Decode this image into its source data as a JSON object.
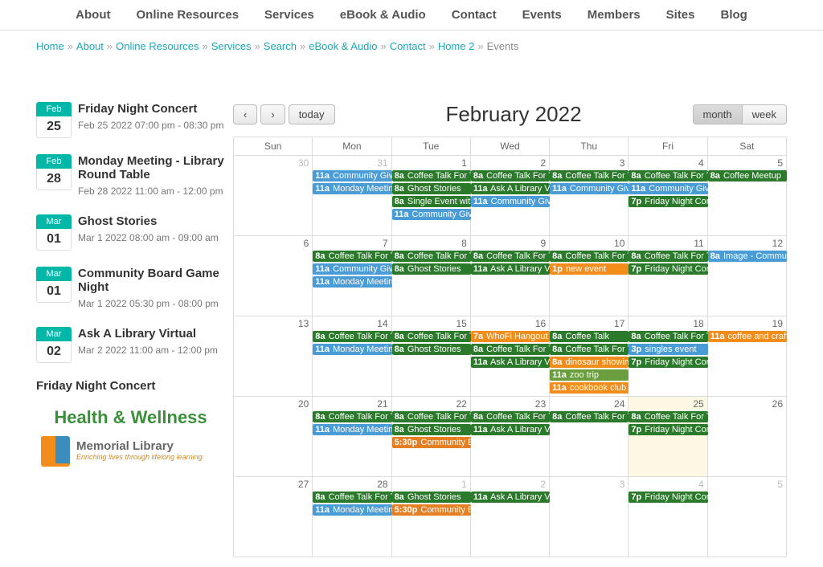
{
  "nav": [
    "About",
    "Online Resources",
    "Services",
    "eBook & Audio",
    "Contact",
    "Events",
    "Members",
    "Sites",
    "Blog"
  ],
  "breadcrumb": [
    "Home",
    "About",
    "Online Resources",
    "Services",
    "Search",
    "eBook & Audio",
    "Contact",
    "Home 2",
    "Events"
  ],
  "sidebar_events": [
    {
      "month": "Feb",
      "day": "25",
      "title": "Friday Night Concert",
      "time": "Feb 25 2022 07:00 pm - 08:30 pm"
    },
    {
      "month": "Feb",
      "day": "28",
      "title": "Monday Meeting - Library Round Table",
      "time": "Feb 28 2022 11:00 am - 12:00 pm"
    },
    {
      "month": "Mar",
      "day": "01",
      "title": "Ghost Stories",
      "time": "Mar 1 2022 08:00 am - 09:00 am"
    },
    {
      "month": "Mar",
      "day": "01",
      "title": "Community Board Game Night",
      "time": "Mar 1 2022 05:30 pm - 08:00 pm"
    },
    {
      "month": "Mar",
      "day": "02",
      "title": "Ask A Library Virtual",
      "time": "Mar 2 2022 11:00 am - 12:00 pm"
    }
  ],
  "sidebar_cut": "Friday Night Concert",
  "hw_title": "Health & Wellness",
  "logo": {
    "line1": "Memorial Library",
    "line2": "Enriching lives through lifelong learning"
  },
  "cal": {
    "title": "February 2022",
    "today_btn": "today",
    "month_btn": "month",
    "week_btn": "week",
    "dow": [
      "Sun",
      "Mon",
      "Tue",
      "Wed",
      "Thu",
      "Fri",
      "Sat"
    ],
    "weeks": [
      [
        {
          "d": "30",
          "other": true,
          "events": []
        },
        {
          "d": "31",
          "other": true,
          "events": [
            {
              "t": "11a",
              "txt": "Community Givi",
              "c": "c-blue"
            },
            {
              "t": "11a",
              "txt": "Monday Meeting",
              "c": "c-blue"
            }
          ]
        },
        {
          "d": "1",
          "events": [
            {
              "t": "8a",
              "txt": "Coffee Talk For T",
              "c": "c-green"
            },
            {
              "t": "8a",
              "txt": "Ghost Stories",
              "c": "c-green"
            },
            {
              "t": "8a",
              "txt": "Single Event with",
              "c": "c-green"
            },
            {
              "t": "11a",
              "txt": "Community Givi",
              "c": "c-blue"
            }
          ]
        },
        {
          "d": "2",
          "events": [
            {
              "t": "8a",
              "txt": "Coffee Talk For T",
              "c": "c-green"
            },
            {
              "t": "11a",
              "txt": "Ask A Library Vir",
              "c": "c-green"
            },
            {
              "t": "11a",
              "txt": "Community Givi",
              "c": "c-blue"
            }
          ]
        },
        {
          "d": "3",
          "events": [
            {
              "t": "8a",
              "txt": "Coffee Talk For T",
              "c": "c-green"
            },
            {
              "t": "11a",
              "txt": "Community Givi",
              "c": "c-blue"
            }
          ]
        },
        {
          "d": "4",
          "events": [
            {
              "t": "8a",
              "txt": "Coffee Talk For T",
              "c": "c-green"
            },
            {
              "t": "11a",
              "txt": "Community Givi",
              "c": "c-blue"
            },
            {
              "t": "7p",
              "txt": "Friday Night Conc",
              "c": "c-green"
            }
          ]
        },
        {
          "d": "5",
          "events": [
            {
              "t": "8a",
              "txt": "Coffee Meetup",
              "c": "c-green"
            }
          ]
        }
      ],
      [
        {
          "d": "6",
          "events": []
        },
        {
          "d": "7",
          "events": [
            {
              "t": "8a",
              "txt": "Coffee Talk For T",
              "c": "c-green"
            },
            {
              "t": "11a",
              "txt": "Community Givi",
              "c": "c-blue"
            },
            {
              "t": "11a",
              "txt": "Monday Meeting",
              "c": "c-blue"
            }
          ]
        },
        {
          "d": "8",
          "events": [
            {
              "t": "8a",
              "txt": "Coffee Talk For T",
              "c": "c-green"
            },
            {
              "t": "8a",
              "txt": "Ghost Stories",
              "c": "c-green"
            }
          ]
        },
        {
          "d": "9",
          "events": [
            {
              "t": "8a",
              "txt": "Coffee Talk For T",
              "c": "c-green"
            },
            {
              "t": "11a",
              "txt": "Ask A Library Vir",
              "c": "c-green"
            }
          ]
        },
        {
          "d": "10",
          "events": [
            {
              "t": "8a",
              "txt": "Coffee Talk For T",
              "c": "c-green"
            },
            {
              "t": "1p",
              "txt": "new event",
              "c": "c-orange"
            }
          ]
        },
        {
          "d": "11",
          "events": [
            {
              "t": "8a",
              "txt": "Coffee Talk For T",
              "c": "c-green"
            },
            {
              "t": "7p",
              "txt": "Friday Night Conc",
              "c": "c-green"
            }
          ]
        },
        {
          "d": "12",
          "events": [
            {
              "t": "8a",
              "txt": "Image - Commun",
              "c": "c-blue"
            }
          ]
        }
      ],
      [
        {
          "d": "13",
          "events": []
        },
        {
          "d": "14",
          "events": [
            {
              "t": "8a",
              "txt": "Coffee Talk For T",
              "c": "c-green"
            },
            {
              "t": "11a",
              "txt": "Monday Meeting",
              "c": "c-blue"
            }
          ]
        },
        {
          "d": "15",
          "events": [
            {
              "t": "8a",
              "txt": "Coffee Talk For T",
              "c": "c-green"
            },
            {
              "t": "8a",
              "txt": "Ghost Stories",
              "c": "c-green"
            }
          ]
        },
        {
          "d": "16",
          "events": [
            {
              "t": "7a",
              "txt": "WhoFi Hangout",
              "c": "c-orange"
            },
            {
              "t": "8a",
              "txt": "Coffee Talk For T",
              "c": "c-green"
            },
            {
              "t": "11a",
              "txt": "Ask A Library Vir",
              "c": "c-green"
            }
          ]
        },
        {
          "d": "17",
          "events": [
            {
              "t": "8a",
              "txt": "Coffee Talk",
              "c": "c-green"
            },
            {
              "t": "8a",
              "txt": "Coffee Talk For T",
              "c": "c-green"
            },
            {
              "t": "8a",
              "txt": "dinosaur showing",
              "c": "c-orange"
            },
            {
              "t": "11a",
              "txt": "zoo trip",
              "c": "c-olive"
            },
            {
              "t": "11a",
              "txt": "cookbook club",
              "c": "c-orange"
            }
          ]
        },
        {
          "d": "18",
          "events": [
            {
              "t": "8a",
              "txt": "Coffee Talk For T",
              "c": "c-green"
            },
            {
              "t": "3p",
              "txt": "singles event",
              "c": "c-blue"
            },
            {
              "t": "7p",
              "txt": "Friday Night Conc",
              "c": "c-green"
            }
          ]
        },
        {
          "d": "19",
          "events": [
            {
              "t": "11a",
              "txt": "coffee and crafts",
              "c": "c-orange"
            }
          ]
        }
      ],
      [
        {
          "d": "20",
          "events": []
        },
        {
          "d": "21",
          "events": [
            {
              "t": "8a",
              "txt": "Coffee Talk For T",
              "c": "c-green"
            },
            {
              "t": "11a",
              "txt": "Monday Meeting",
              "c": "c-blue"
            }
          ]
        },
        {
          "d": "22",
          "events": [
            {
              "t": "8a",
              "txt": "Coffee Talk For T",
              "c": "c-green"
            },
            {
              "t": "8a",
              "txt": "Ghost Stories",
              "c": "c-green"
            },
            {
              "t": "5:30p",
              "txt": "Community Bo",
              "c": "c-orange2"
            }
          ]
        },
        {
          "d": "23",
          "events": [
            {
              "t": "8a",
              "txt": "Coffee Talk For T",
              "c": "c-green"
            },
            {
              "t": "11a",
              "txt": "Ask A Library Vir",
              "c": "c-green"
            }
          ]
        },
        {
          "d": "24",
          "events": [
            {
              "t": "8a",
              "txt": "Coffee Talk For T",
              "c": "c-green"
            }
          ]
        },
        {
          "d": "25",
          "today": true,
          "events": [
            {
              "t": "8a",
              "txt": "Coffee Talk For T",
              "c": "c-green"
            },
            {
              "t": "7p",
              "txt": "Friday Night Conc",
              "c": "c-green"
            }
          ]
        },
        {
          "d": "26",
          "events": []
        }
      ],
      [
        {
          "d": "27",
          "events": []
        },
        {
          "d": "28",
          "events": [
            {
              "t": "8a",
              "txt": "Coffee Talk For T",
              "c": "c-green"
            },
            {
              "t": "11a",
              "txt": "Monday Meeting",
              "c": "c-blue"
            }
          ]
        },
        {
          "d": "1",
          "other": true,
          "events": [
            {
              "t": "8a",
              "txt": "Ghost Stories",
              "c": "c-green"
            },
            {
              "t": "5:30p",
              "txt": "Community Bo",
              "c": "c-orange2"
            }
          ]
        },
        {
          "d": "2",
          "other": true,
          "events": [
            {
              "t": "11a",
              "txt": "Ask A Library Vir",
              "c": "c-green"
            }
          ]
        },
        {
          "d": "3",
          "other": true,
          "events": []
        },
        {
          "d": "4",
          "other": true,
          "events": [
            {
              "t": "7p",
              "txt": "Friday Night Conc",
              "c": "c-green"
            }
          ]
        },
        {
          "d": "5",
          "other": true,
          "events": []
        }
      ]
    ]
  }
}
